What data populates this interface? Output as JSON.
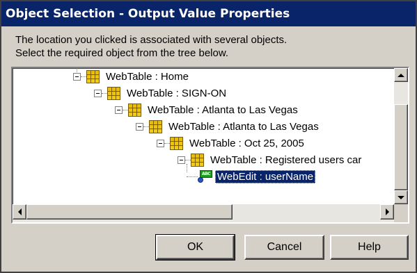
{
  "window": {
    "title": "Object Selection - Output Value Properties"
  },
  "description": {
    "line1": "The location you clicked is associated with several objects.",
    "line2": "Select the required object from the tree below."
  },
  "tree": {
    "nodes": [
      {
        "label": "WebTable : Home",
        "icon": "webtable-icon"
      },
      {
        "label": "WebTable : SIGN-ON",
        "icon": "webtable-icon"
      },
      {
        "label": "WebTable : Atlanta to Las Vegas",
        "icon": "webtable-icon"
      },
      {
        "label": "WebTable : Atlanta to Las Vegas",
        "icon": "webtable-icon"
      },
      {
        "label": "WebTable : Oct 25, 2005",
        "icon": "webtable-icon"
      },
      {
        "label": "WebTable : Registered users car",
        "icon": "webtable-icon"
      },
      {
        "label": "WebEdit : userName",
        "icon": "webedit-icon",
        "selected": true,
        "icon_text": "ABC"
      }
    ]
  },
  "buttons": {
    "ok": "OK",
    "cancel": "Cancel",
    "help": "Help"
  },
  "colors": {
    "titlebar": "#0a246a",
    "dialog_face": "#d4d0c8",
    "selection": "#0a246a"
  }
}
